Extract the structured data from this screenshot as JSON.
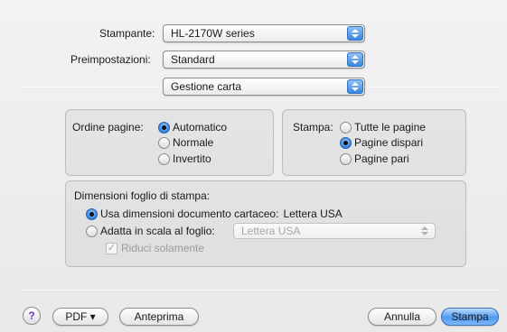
{
  "printer": {
    "label": "Stampante:",
    "value": "HL-2170W series"
  },
  "presets": {
    "label": "Preimpostazioni:",
    "value": "Standard"
  },
  "panel": {
    "value": "Gestione carta"
  },
  "page_order": {
    "label": "Ordine pagine:",
    "options": [
      "Automatico",
      "Normale",
      "Invertito"
    ],
    "selected": "Automatico"
  },
  "print_pages": {
    "label": "Stampa:",
    "options": [
      "Tutte le pagine",
      "Pagine dispari",
      "Pagine pari"
    ],
    "selected": "Pagine dispari"
  },
  "paper_size": {
    "label": "Dimensioni foglio di stampa:",
    "use_document": "Usa dimensioni documento cartaceo:",
    "document_size": "Lettera USA",
    "scale_to_fit": "Adatta in scala al foglio:",
    "scale_popup": "Lettera USA",
    "scale_down_only": "Riduci solamente",
    "scale_down_checked": true
  },
  "footer": {
    "help": "?",
    "pdf": "PDF ▾",
    "preview": "Anteprima",
    "cancel": "Annulla",
    "print": "Stampa"
  },
  "colors": {
    "accent": "#3a86e2",
    "default_button": "#4f9bf0"
  }
}
